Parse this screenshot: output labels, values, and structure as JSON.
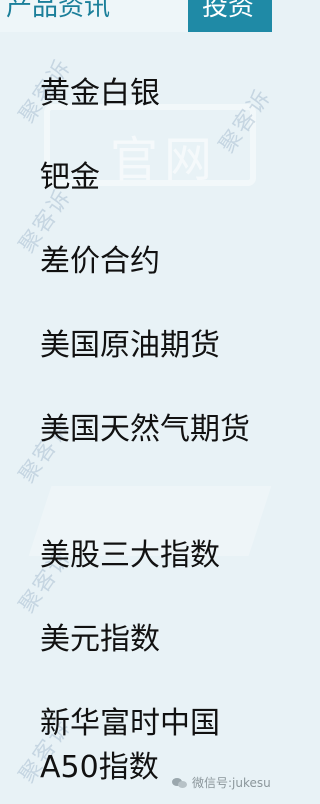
{
  "header": {
    "left_tab_label": "产品资讯",
    "active_tab_label": "投资"
  },
  "watermark": {
    "repeat_text": "聚客诉",
    "logo_text": "官网"
  },
  "menu": {
    "items": [
      {
        "label": "黄金白银"
      },
      {
        "label": "钯金"
      },
      {
        "label": "差价合约"
      },
      {
        "label": "美国原油期货"
      },
      {
        "label": "美国天然气期货"
      },
      {
        "label": "美股三大指数"
      },
      {
        "label": "美元指数"
      },
      {
        "label": "新华富时中国A50指数"
      }
    ]
  },
  "footer": {
    "wechat_label": "微信号:jukesu",
    "icon": "wechat-icon"
  },
  "colors": {
    "background": "#e8f2f6",
    "accent": "#1f8aa6",
    "menu_text": "#111111"
  }
}
